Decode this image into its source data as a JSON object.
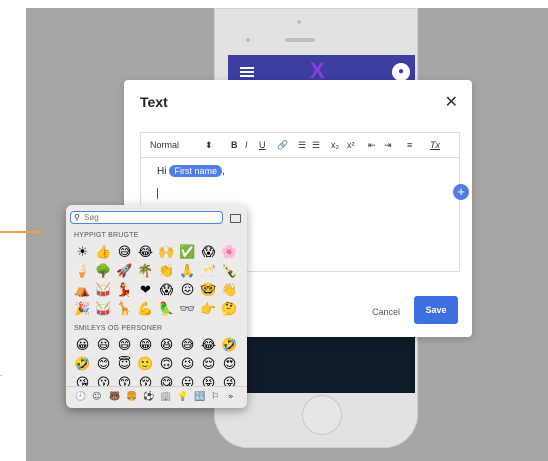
{
  "modal": {
    "title": "Text",
    "close": "✕",
    "cancel": "Cancel",
    "save": "Save",
    "plus": "+"
  },
  "toolbar": {
    "style_select": "Normal",
    "style_arrows": "⬍",
    "bold": "B",
    "italic": "I",
    "underline": "U",
    "link": "🔗",
    "ordered_list": "☰",
    "bullet_list": "☰",
    "subscript": "x₂",
    "superscript": "x²",
    "indent_left": "⇤",
    "indent_right": "⇥",
    "align": "≡",
    "clear_format": "Tx"
  },
  "editor": {
    "greeting": "Hi",
    "chip": "First name",
    "after_chip": ","
  },
  "emoji_picker": {
    "search_placeholder": "Søg",
    "section_frequent": "HYPPIGT BRUGTE",
    "section_smileys": "SMILEYS OG PERSONER",
    "frequent": [
      "☀",
      "👍",
      "😅",
      "😂",
      "🙌",
      "✅",
      "😱",
      "🌸",
      "🍦",
      "🌳",
      "🚀",
      "🌴",
      "👏",
      "🙏",
      "🥂",
      "🍾",
      "⛺",
      "🥁",
      "💃",
      "❤",
      "😱",
      "😖",
      "🤓",
      "👋",
      "🎉",
      "🥁",
      "🦒",
      "💪",
      "🦜",
      "👓",
      "👉",
      "🤔"
    ],
    "smileys": [
      "😀",
      "😃",
      "😄",
      "😁",
      "😆",
      "😅",
      "😂",
      "🤣",
      "🤣",
      "😊",
      "😇",
      "🙂",
      "🙃",
      "😉",
      "😌",
      "😍",
      "😘",
      "😗",
      "😙",
      "😚",
      "😋",
      "😛",
      "😝",
      "😜"
    ],
    "categories": [
      "🕘",
      "☺",
      "🐻",
      "🍔",
      "⚽",
      "🏢",
      "💡",
      "🔣",
      "⚐",
      "»"
    ]
  },
  "phone": {
    "logo": "X"
  },
  "colors": {
    "accent": "#3d6fe0",
    "chip": "#4f7ee6",
    "phone_header": "#3d3ea2",
    "backdrop": "#a6a6a6"
  }
}
